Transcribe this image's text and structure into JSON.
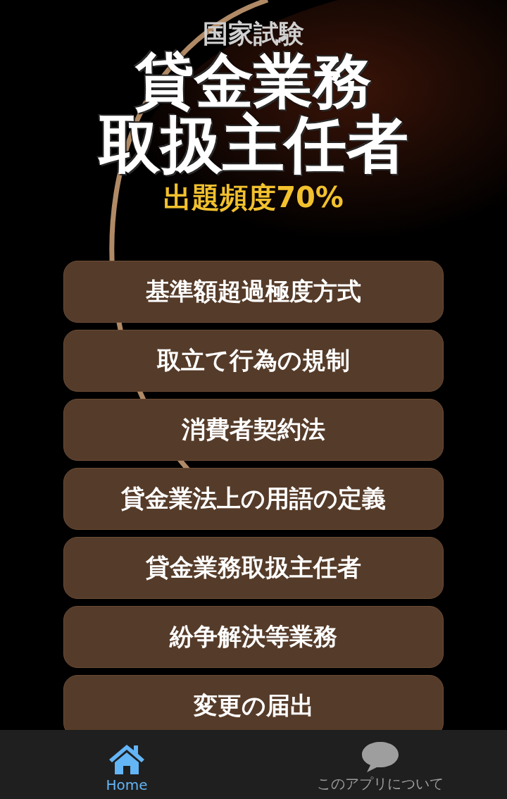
{
  "banner": {
    "overline": "国家試験",
    "title_lines": [
      "貸金業務",
      "取扱主任者"
    ],
    "tagline": "出題頻度70%"
  },
  "topics": [
    "基準額超過極度方式",
    "取立て行為の規制",
    "消費者契約法",
    "貸金業法上の用語の定義",
    "貸金業務取扱主任者",
    "紛争解決等業務",
    "変更の届出"
  ],
  "bottom_nav": [
    {
      "label": "Home",
      "selected": true
    },
    {
      "label": "このアプリについて",
      "selected": false
    }
  ]
}
